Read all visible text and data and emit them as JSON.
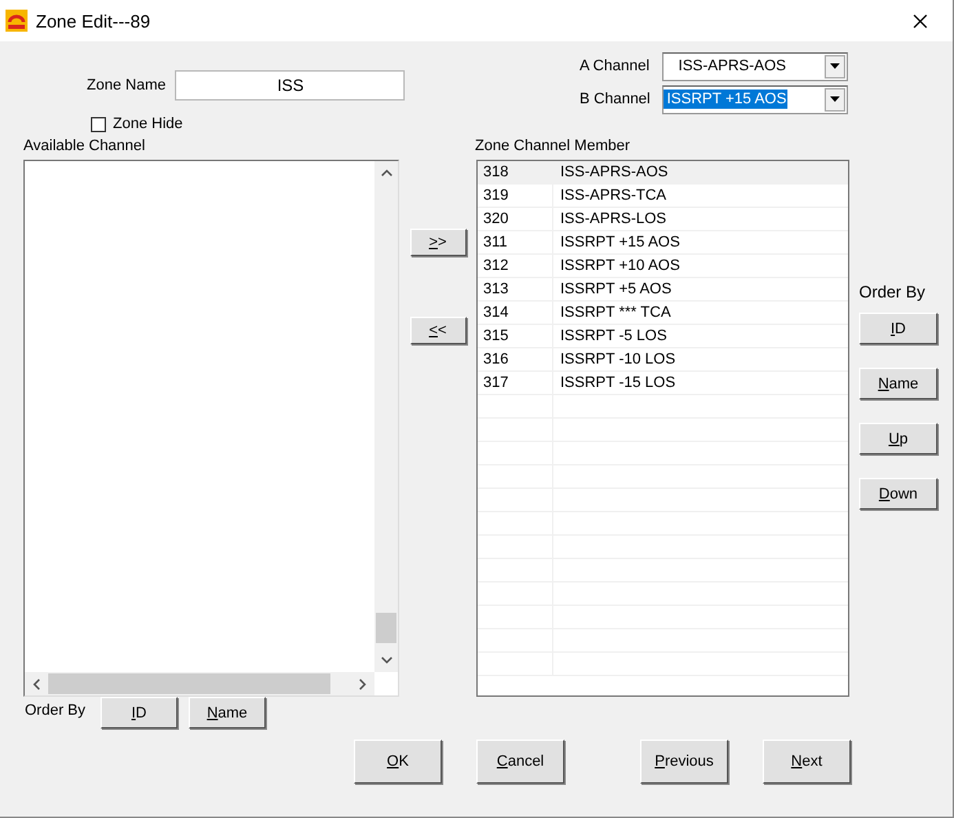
{
  "window": {
    "title": "Zone Edit---89"
  },
  "zone_name": {
    "label": "Zone Name",
    "value": "ISS"
  },
  "zone_hide": {
    "label": "Zone Hide",
    "checked": false
  },
  "a_channel": {
    "label": "A Channel",
    "value": "ISS-APRS-AOS",
    "text_selected": false
  },
  "b_channel": {
    "label": "B Channel",
    "value": "ISSRPT +15 AOS",
    "text_selected": true
  },
  "available_channel": {
    "label": "Available Channel"
  },
  "transfer_buttons": [
    ">>",
    "<<"
  ],
  "zone_channel_member": {
    "label": "Zone Channel Member",
    "rows": [
      {
        "id": "318",
        "name": "ISS-APRS-AOS",
        "selected": true
      },
      {
        "id": "319",
        "name": "ISS-APRS-TCA",
        "selected": false
      },
      {
        "id": "320",
        "name": "ISS-APRS-LOS",
        "selected": false
      },
      {
        "id": "311",
        "name": "ISSRPT +15 AOS",
        "selected": false
      },
      {
        "id": "312",
        "name": "ISSRPT +10 AOS",
        "selected": false
      },
      {
        "id": "313",
        "name": "ISSRPT +5 AOS",
        "selected": false
      },
      {
        "id": "314",
        "name": "ISSRPT *** TCA",
        "selected": false
      },
      {
        "id": "315",
        "name": "ISSRPT -5 LOS",
        "selected": false
      },
      {
        "id": "316",
        "name": "ISSRPT -10 LOS",
        "selected": false
      },
      {
        "id": "317",
        "name": "ISSRPT -15 LOS",
        "selected": false
      }
    ]
  },
  "member_order": {
    "label": "Order By",
    "buttons": [
      "ID",
      "Name",
      "Up",
      "Down"
    ]
  },
  "available_order": {
    "label": "Order By",
    "buttons": [
      "ID",
      "Name"
    ]
  },
  "dialog_buttons": [
    "OK",
    "Cancel",
    "Previous",
    "Next"
  ]
}
